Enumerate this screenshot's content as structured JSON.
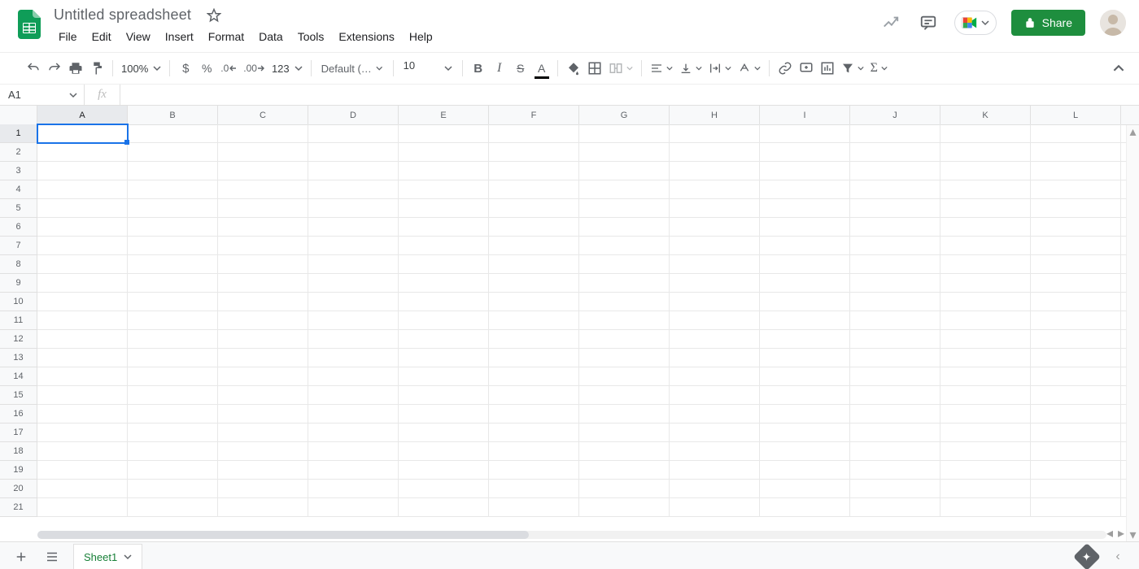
{
  "doc": {
    "title": "Untitled spreadsheet"
  },
  "menus": [
    "File",
    "Edit",
    "View",
    "Insert",
    "Format",
    "Data",
    "Tools",
    "Extensions",
    "Help"
  ],
  "share": {
    "label": "Share"
  },
  "toolbar": {
    "zoom": "100%",
    "font": "Default (Ari...",
    "font_size": "10",
    "more_formats": "123"
  },
  "name_box": {
    "value": "A1"
  },
  "formula_bar": {
    "fx": "fx",
    "value": ""
  },
  "grid": {
    "columns": [
      "A",
      "B",
      "C",
      "D",
      "E",
      "F",
      "G",
      "H",
      "I",
      "J",
      "K",
      "L"
    ],
    "rows": [
      "1",
      "2",
      "3",
      "4",
      "5",
      "6",
      "7",
      "8",
      "9",
      "10",
      "11",
      "12",
      "13",
      "14",
      "15",
      "16",
      "17",
      "18",
      "19",
      "20",
      "21"
    ],
    "active_cell": "A1"
  },
  "sheet_tab": {
    "name": "Sheet1"
  }
}
